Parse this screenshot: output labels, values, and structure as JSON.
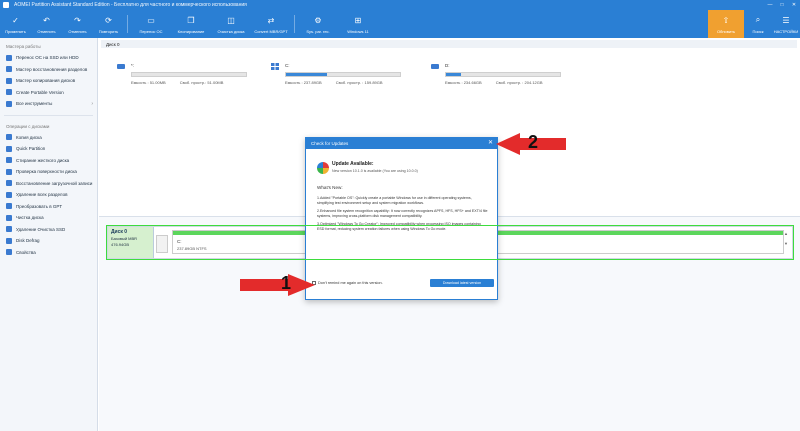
{
  "window": {
    "title": "AOMEI Partition Assistant Standard Edition - Бесплатно для частного и коммерческого использования",
    "minimize": "—",
    "maximize": "□",
    "close": "✕"
  },
  "toolbar": {
    "items": [
      {
        "label": "Применить",
        "icon": "check-icon"
      },
      {
        "label": "Отменить",
        "icon": "undo-icon"
      },
      {
        "label": "Отменить",
        "icon": "redo-icon"
      },
      {
        "label": "Повторить",
        "icon": "refresh-icon"
      },
      {
        "label": "Перенос ОС",
        "icon": "migrate-os-icon"
      },
      {
        "label": "Клонирование",
        "icon": "clone-icon"
      },
      {
        "label": "Очистка диска",
        "icon": "wipe-icon"
      },
      {
        "label": "Convert MBR/GPT",
        "icon": "convert-icon"
      },
      {
        "label": "Sys. par. rec.",
        "icon": "tools-icon"
      },
      {
        "label": "Windows 11",
        "icon": "windows-icon"
      }
    ],
    "right": [
      {
        "label": "Обновить",
        "icon": "upgrade-icon"
      },
      {
        "label": "Поиск",
        "icon": "search-icon"
      },
      {
        "label": "НАСТРОЙКИ",
        "icon": "menu-icon"
      }
    ]
  },
  "sidebar": {
    "wizards_header": "Мастера работы",
    "wizards": [
      {
        "label": "Перенос ОС на SSD или HDD"
      },
      {
        "label": "Мастер восстановления разделов"
      },
      {
        "label": "Мастер копирования дисков"
      },
      {
        "label": "Create Portable Version"
      },
      {
        "label": "Все инструменты",
        "chevron": "›"
      }
    ],
    "operations_header": "Операции с дисками",
    "operations": [
      {
        "label": "Копия диска"
      },
      {
        "label": "Quick Partition"
      },
      {
        "label": "Стирание жесткого диска"
      },
      {
        "label": "Проверка поверхности диска"
      },
      {
        "label": "Восстановление загрузочной записи"
      },
      {
        "label": "Удаление всех разделов"
      },
      {
        "label": "Преобразовать в GPT"
      },
      {
        "label": "Чистка диска"
      },
      {
        "label": "Удаление Очистка SSD"
      },
      {
        "label": "Disk Defrag"
      },
      {
        "label": "Свойства"
      }
    ]
  },
  "main": {
    "disk_tab": "Диск 0",
    "partitions": [
      {
        "label": "*:",
        "capacity": "Емкость : 51.00MB",
        "free": "Своб. простр.: 51.00MB",
        "usage": 0
      },
      {
        "label": "C:",
        "capacity": "Емкость : 237.89GB",
        "free": "Своб. простр. : 159.89GB",
        "usage": 0.36
      },
      {
        "label": "D:",
        "capacity": "Емкость : 234.66GB",
        "free": "Своб. простр. : 204.12GB",
        "usage": 0.13
      }
    ],
    "disk_row": {
      "name": "Диск 0",
      "type": "Базовый MBR",
      "size": "476.94GB",
      "part_label": "C:",
      "part_size": "237.89GB NTFS"
    }
  },
  "dialog": {
    "title": "Check for Updates",
    "close": "✕",
    "heading": "Update Available:",
    "version": "New version 10.1.0 is available (You are using 10.0.0)",
    "whats_new": "What's New:",
    "notes": [
      "1.Added \"Portable OS\": Quickly create a portable Windows for use in different operating systems, simplifying test environment setup and system migration workflows.",
      "2.Enhanced file system recognition capability: It now correctly recognizes APFS, HFS, HFS+ and EXT/4 file systems, improving cross-platform disk management compatibility.",
      "3.Optimized \"Windows To Go Creator\": Improved compatibility when processing ISO images containing ESD format, reducing system creation failures when using Windows To Go mode."
    ],
    "dont_remind": "Don't remind me again on this version.",
    "download_button": "Download latest version"
  },
  "annotations": {
    "badge_1": "1",
    "badge_2": "2",
    "arrow_color": "#e32b2b",
    "highlight_color": "#3ddc3d"
  }
}
